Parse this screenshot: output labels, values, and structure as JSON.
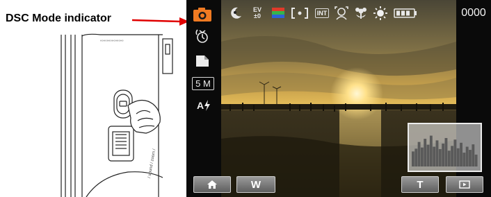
{
  "annotation": {
    "label": "DSC Mode indicator",
    "arrow_color": "#e00000"
  },
  "camera_screen": {
    "left_column": {
      "dsc_mode_icon": "camera-icon",
      "dsc_mode_color": "#f07a22",
      "self_timer_icon": "self-timer-icon",
      "capture_mode_icon": "single-shot-icon",
      "resolution": "5 M",
      "flash_icon": "auto-flash-icon",
      "flash_label": "A"
    },
    "top_row": {
      "icons": [
        "night-scene-icon",
        "ev-icon",
        "color-mode-icon",
        "metering-spot-icon",
        "internal-memory-icon",
        "face-detect-icon",
        "macro-icon",
        "white-balance-icon",
        "battery-icon"
      ],
      "ev_top": "EV",
      "ev_value": "±0",
      "memory_label": "INT"
    },
    "shot_count": "0000",
    "histogram_levels": [
      0.38,
      0.45,
      0.62,
      0.48,
      0.7,
      0.55,
      0.78,
      0.5,
      0.66,
      0.44,
      0.58,
      0.72,
      0.4,
      0.52,
      0.68,
      0.46,
      0.6,
      0.35,
      0.5,
      0.42,
      0.56,
      0.3
    ],
    "buttons": {
      "home_icon": "home-icon",
      "wide_label": "W",
      "tele_label": "T",
      "playback_icon": "playback-icon"
    }
  }
}
